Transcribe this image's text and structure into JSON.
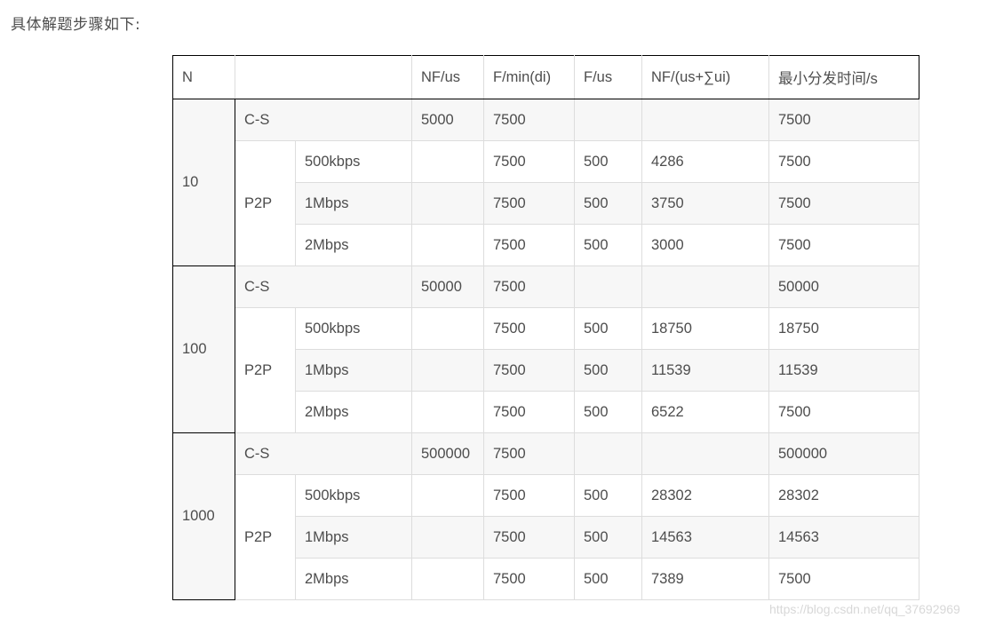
{
  "intro_text": "具体解题步骤如下:",
  "table": {
    "headers": [
      "N",
      "",
      "NF/us",
      "F/min(di)",
      "F/us",
      "NF/(us+∑ui)",
      "最小分发时间/s"
    ],
    "groups": [
      {
        "n": "10",
        "cs": {
          "label": "C-S",
          "nf_us": "5000",
          "f_min_di": "7500",
          "f_us": "",
          "nf_sum": "",
          "min_time": "7500"
        },
        "p2p_label": "P2P",
        "p2p": [
          {
            "rate": "500kbps",
            "nf_us": "",
            "f_min_di": "7500",
            "f_us": "500",
            "nf_sum": "4286",
            "min_time": "7500"
          },
          {
            "rate": "1Mbps",
            "nf_us": "",
            "f_min_di": "7500",
            "f_us": "500",
            "nf_sum": "3750",
            "min_time": "7500"
          },
          {
            "rate": "2Mbps",
            "nf_us": "",
            "f_min_di": "7500",
            "f_us": "500",
            "nf_sum": "3000",
            "min_time": "7500"
          }
        ]
      },
      {
        "n": "100",
        "cs": {
          "label": "C-S",
          "nf_us": "50000",
          "f_min_di": "7500",
          "f_us": "",
          "nf_sum": "",
          "min_time": "50000"
        },
        "p2p_label": "P2P",
        "p2p": [
          {
            "rate": "500kbps",
            "nf_us": "",
            "f_min_di": "7500",
            "f_us": "500",
            "nf_sum": "18750",
            "min_time": "18750"
          },
          {
            "rate": "1Mbps",
            "nf_us": "",
            "f_min_di": "7500",
            "f_us": "500",
            "nf_sum": "11539",
            "min_time": "11539"
          },
          {
            "rate": "2Mbps",
            "nf_us": "",
            "f_min_di": "7500",
            "f_us": "500",
            "nf_sum": "6522",
            "min_time": "7500"
          }
        ]
      },
      {
        "n": "1000",
        "cs": {
          "label": "C-S",
          "nf_us": "500000",
          "f_min_di": "7500",
          "f_us": "",
          "nf_sum": "",
          "min_time": "500000"
        },
        "p2p_label": "P2P",
        "p2p": [
          {
            "rate": "500kbps",
            "nf_us": "",
            "f_min_di": "7500",
            "f_us": "500",
            "nf_sum": "28302",
            "min_time": "28302"
          },
          {
            "rate": "1Mbps",
            "nf_us": "",
            "f_min_di": "7500",
            "f_us": "500",
            "nf_sum": "14563",
            "min_time": "14563"
          },
          {
            "rate": "2Mbps",
            "nf_us": "",
            "f_min_di": "7500",
            "f_us": "500",
            "nf_sum": "7389",
            "min_time": "7500"
          }
        ]
      }
    ]
  },
  "watermark": "https://blog.csdn.net/qq_37692969"
}
